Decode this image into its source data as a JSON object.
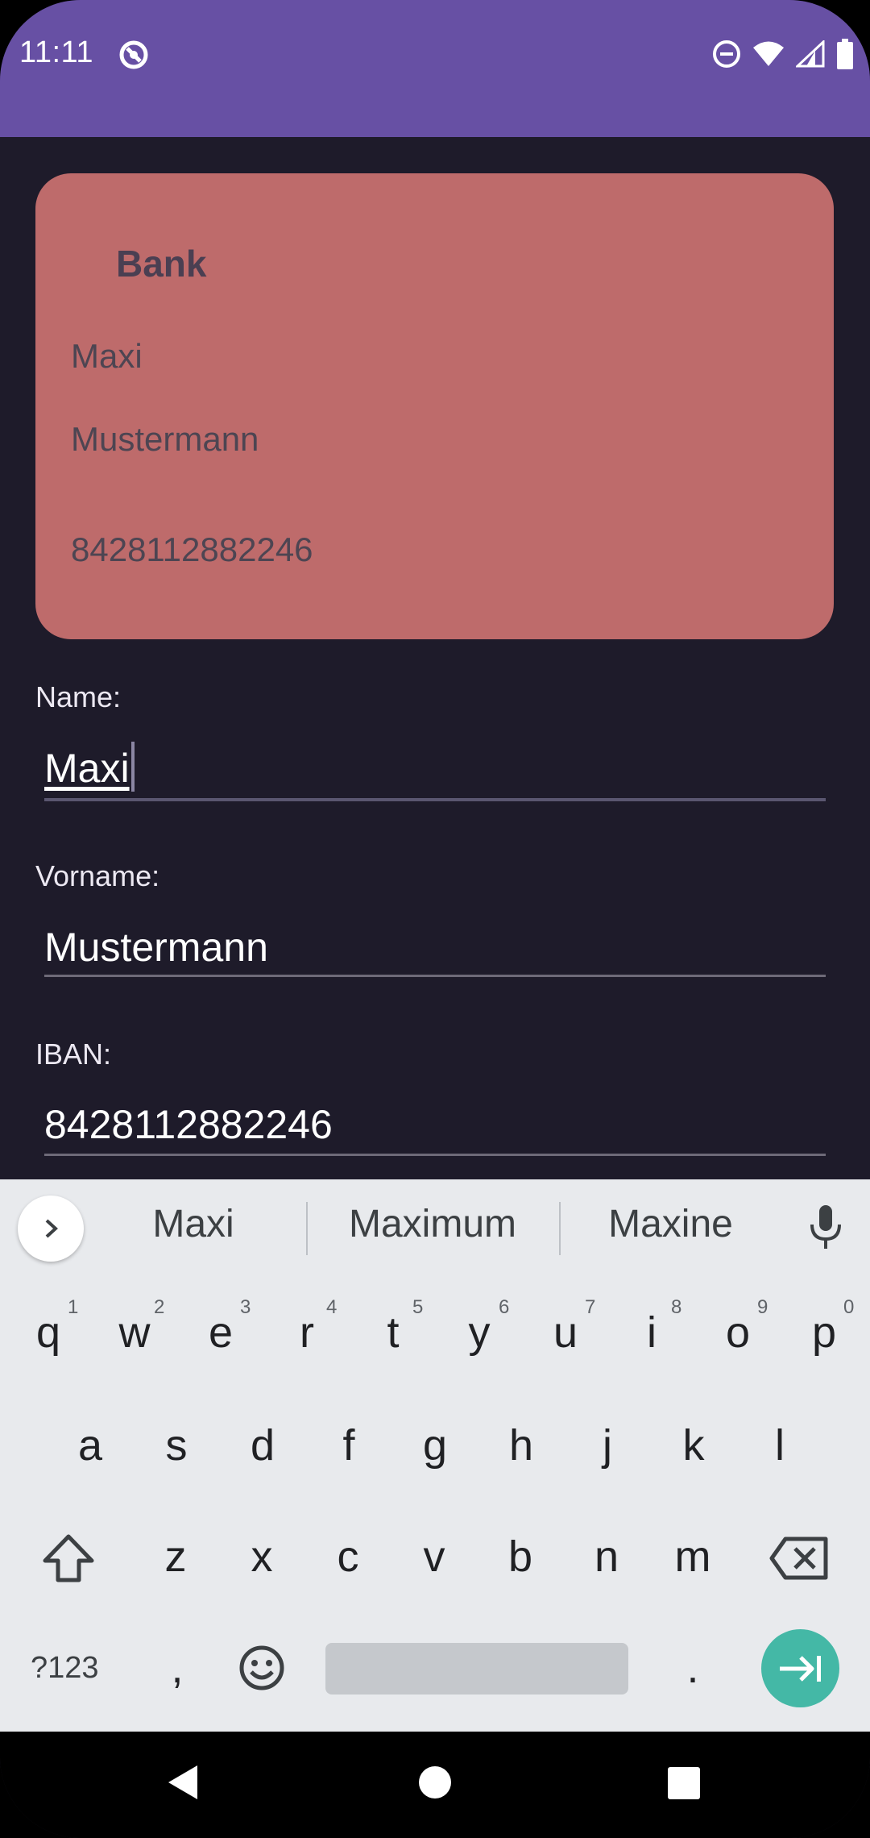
{
  "status_bar": {
    "time": "11:11"
  },
  "card": {
    "title": "Bank",
    "first_name": "Maxi",
    "last_name": "Mustermann",
    "iban": "8428112882246"
  },
  "form": {
    "name_label": "Name:",
    "name_value": "Maxi",
    "vorname_label": "Vorname:",
    "vorname_value": "Mustermann",
    "iban_label": "IBAN:",
    "iban_value": "8428112882246"
  },
  "keyboard": {
    "suggestions": [
      "Maxi",
      "Maximum",
      "Maxine"
    ],
    "row1": [
      "q",
      "w",
      "e",
      "r",
      "t",
      "y",
      "u",
      "i",
      "o",
      "p"
    ],
    "row1_hints": [
      "1",
      "2",
      "3",
      "4",
      "5",
      "6",
      "7",
      "8",
      "9",
      "0"
    ],
    "row2": [
      "a",
      "s",
      "d",
      "f",
      "g",
      "h",
      "j",
      "k",
      "l"
    ],
    "row3": [
      "z",
      "x",
      "c",
      "v",
      "b",
      "n",
      "m"
    ],
    "symbols_label": "?123",
    "comma": ",",
    "period": "."
  },
  "colors": {
    "app_bar": "#6750a4",
    "background": "#1e1b2a",
    "card": "#be6b6b",
    "enter_key": "#44b8a6"
  }
}
